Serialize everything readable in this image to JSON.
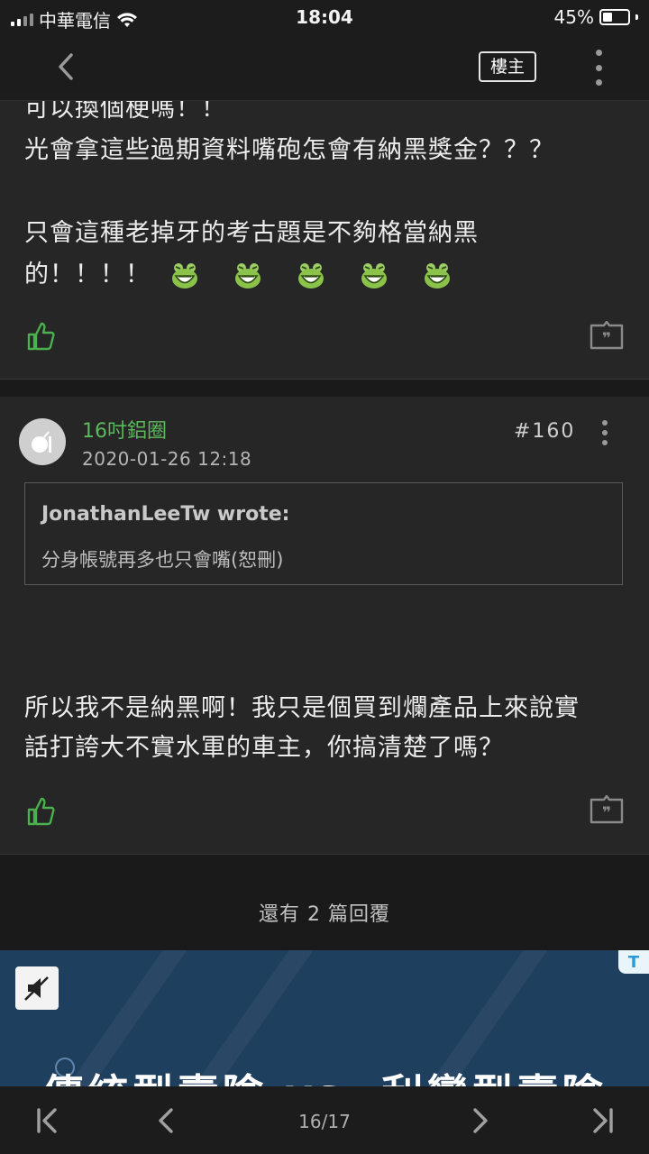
{
  "status_bar": {
    "carrier": "中華電信",
    "time": "18:04",
    "battery": "45%",
    "battery_level": 0.45
  },
  "nav": {
    "op_label": "樓主"
  },
  "prev_post": {
    "lines": [
      "可以換個梗嗎！！",
      "光會拿這些過期資料嘴砲怎會有納黑獎金？？？",
      "",
      "只會這種老掉牙的考古題是不夠格當納黑",
      "的！！！！"
    ],
    "emoji_count": 5,
    "emoji_icon": "laughing-frog-icon"
  },
  "reply": {
    "username": "16吋鋁圈",
    "timestamp": "2020-01-26 12:18",
    "floor": "#160",
    "quote": {
      "author": "JonathanLeeTw wrote:",
      "text": "分身帳號再多也只會嘴(恕刪)"
    },
    "body_lines": [
      "所以我不是納黑啊！我只是個買到爛產品上來說實",
      "話打誇大不實水軍的車主，你搞清楚了嗎？"
    ]
  },
  "more_replies": "還有 2 篇回覆",
  "ad": {
    "tag": "T",
    "headline": "傳統型壽險 vs. 利變型壽險",
    "mute_icon": "mute-icon"
  },
  "pager": {
    "page": "16/17"
  },
  "colors": {
    "accent_green": "#5cb85c",
    "background": "#1a1a1a",
    "card": "#262626",
    "ad_bg": "#1f3f5e"
  }
}
